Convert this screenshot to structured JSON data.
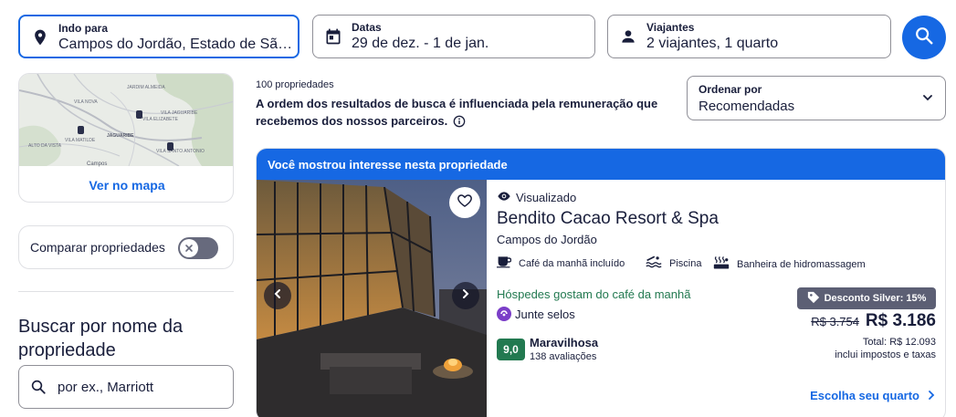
{
  "search": {
    "destination": {
      "label": "Indo para",
      "value": "Campos do Jordão, Estado de São Paulo",
      "icon": "location-pin-icon"
    },
    "dates": {
      "label": "Datas",
      "value": "29 de dez. - 1 de jan.",
      "icon": "calendar-icon"
    },
    "travelers": {
      "label": "Viajantes",
      "value": "2 viajantes, 1 quarto",
      "icon": "person-icon"
    },
    "submit_icon": "search-icon"
  },
  "sidebar": {
    "map": {
      "link_label": "Ver no mapa",
      "labels": [
        "VILA NOVA",
        "JARDIM ALMEIDA",
        "VILA JAGUARIBE",
        "VILA ELIZABETE",
        "VILA SANTO ANTONIO",
        "JAGUARIBE",
        "VILA MATILDE",
        "ALTO DA VISTA",
        "Campos"
      ]
    },
    "compare": {
      "label": "Comparar propriedades",
      "enabled": false
    },
    "by_name": {
      "title": "Buscar por nome da propriedade",
      "placeholder": "por ex., Marriott"
    }
  },
  "results": {
    "count": "100 propriedades",
    "disclaimer": "A ordem dos resultados de busca é influenciada pela remuneração que recebemos dos nossos parceiros.",
    "sort": {
      "label": "Ordenar por",
      "value": "Recomendadas"
    }
  },
  "property": {
    "banner": "Você mostrou interesse nesta propriedade",
    "viewed": "Visualizado",
    "name": "Bendito Cacao Resort & Spa",
    "city": "Campos do Jordão",
    "amenities": [
      {
        "label": "Café da manhã incluído",
        "icon": "coffee-cup-icon"
      },
      {
        "label": "Piscina",
        "icon": "pool-icon"
      },
      {
        "label": "Banheira de hidromassagem",
        "icon": "hot-tub-icon"
      }
    ],
    "highlight": "Hóspedes gostam do café da manhã",
    "loyalty": "Junte selos",
    "rating": {
      "score": "9,0",
      "word": "Maravilhosa",
      "reviews": "138 avaliações"
    },
    "discount": "Desconto Silver: 15%",
    "old_price": "R$ 3.754",
    "price": "R$ 3.186",
    "total": "Total: R$ 12.093",
    "taxes": "inclui impostos e taxas",
    "cta": "Escolha seu quarto"
  },
  "colors": {
    "accent": "#1668e3",
    "text": "#191e3b",
    "positive": "#227950",
    "badge": "#5c5f74"
  }
}
